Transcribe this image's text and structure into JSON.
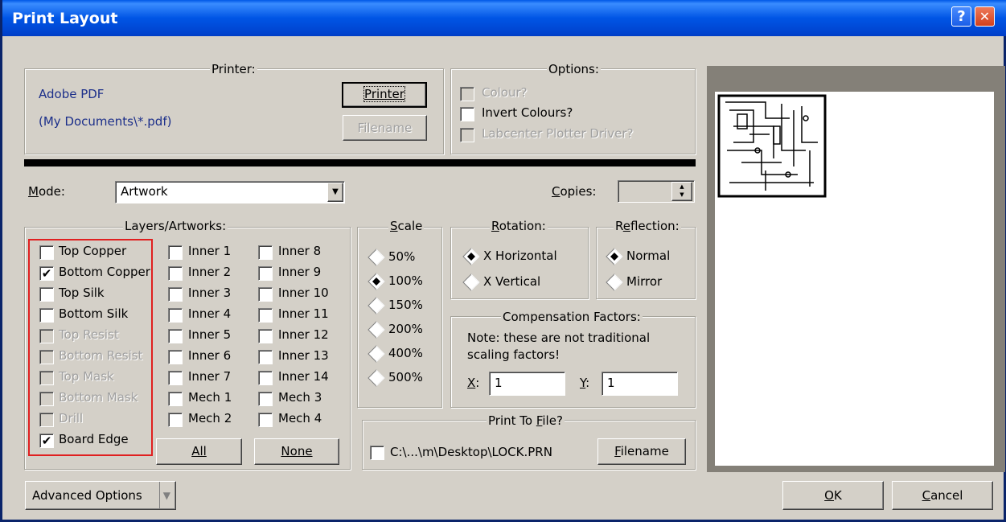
{
  "window": {
    "title": "Print Layout",
    "help_label": "?",
    "close_label": "✕"
  },
  "printer": {
    "group_title": "Printer:",
    "name": "Adobe PDF",
    "path": "(My Documents\\*.pdf)",
    "printer_button": "Printer",
    "filename_button": "Filename"
  },
  "options": {
    "group_title": "Options:",
    "items": [
      {
        "label": "Colour?",
        "checked": false,
        "enabled": false
      },
      {
        "label": "Invert Colours?",
        "checked": false,
        "enabled": true
      },
      {
        "label": "Labcenter Plotter Driver?",
        "checked": false,
        "enabled": false
      }
    ]
  },
  "mode": {
    "label": "Mode:",
    "value": "Artwork"
  },
  "copies": {
    "label": "Copies:",
    "value": ""
  },
  "layers": {
    "group_title": "Layers/Artworks:",
    "col1": [
      {
        "label": "Top Copper",
        "checked": false,
        "enabled": true
      },
      {
        "label": "Bottom Copper",
        "checked": true,
        "enabled": true
      },
      {
        "label": "Top Silk",
        "checked": false,
        "enabled": true
      },
      {
        "label": "Bottom Silk",
        "checked": false,
        "enabled": true
      },
      {
        "label": "Top Resist",
        "checked": false,
        "enabled": false
      },
      {
        "label": "Bottom Resist",
        "checked": false,
        "enabled": false
      },
      {
        "label": "Top Mask",
        "checked": false,
        "enabled": false
      },
      {
        "label": "Bottom Mask",
        "checked": false,
        "enabled": false
      },
      {
        "label": "Drill",
        "checked": false,
        "enabled": false
      },
      {
        "label": "Board Edge",
        "checked": true,
        "enabled": true
      }
    ],
    "col2": [
      "Inner 1",
      "Inner 2",
      "Inner 3",
      "Inner 4",
      "Inner 5",
      "Inner 6",
      "Inner 7",
      "Mech 1",
      "Mech 2"
    ],
    "col3": [
      "Inner 8",
      "Inner 9",
      "Inner 10",
      "Inner 11",
      "Inner 12",
      "Inner 13",
      "Inner 14",
      "Mech 3",
      "Mech 4"
    ],
    "all_button": "All",
    "none_button": "None"
  },
  "scale": {
    "group_title": "Scale",
    "items": [
      "50%",
      "100%",
      "150%",
      "200%",
      "400%",
      "500%"
    ],
    "selected": 1
  },
  "rotation": {
    "group_title": "Rotation:",
    "items": [
      "X Horizontal",
      "X Vertical"
    ],
    "selected": 0
  },
  "reflection": {
    "group_title": "Reflection:",
    "items": [
      "Normal",
      "Mirror"
    ],
    "selected": 0
  },
  "compensation": {
    "group_title": "Compensation Factors:",
    "note": "Note: these are not traditional scaling factors!",
    "x_label": "X:",
    "x_value": "1",
    "y_label": "Y:",
    "y_value": "1"
  },
  "print_to_file": {
    "group_title": "Print To File?",
    "path": "C:\\...\\m\\Desktop\\LOCK.PRN",
    "checked": false,
    "filename_button": "Filename"
  },
  "advanced_button": "Advanced Options",
  "ok_button": "OK",
  "cancel_button": "Cancel",
  "colors": {
    "title_bar": "#0055e5",
    "highlight_border": "#e02020",
    "dialog_bg": "#d4d0c8"
  }
}
